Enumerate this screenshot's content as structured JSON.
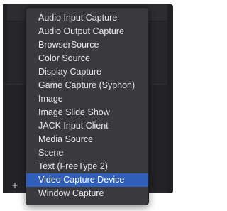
{
  "menu": {
    "items": [
      {
        "label": "Audio Input Capture",
        "selected": false
      },
      {
        "label": "Audio Output Capture",
        "selected": false
      },
      {
        "label": "BrowserSource",
        "selected": false
      },
      {
        "label": "Color Source",
        "selected": false
      },
      {
        "label": "Display Capture",
        "selected": false
      },
      {
        "label": "Game Capture (Syphon)",
        "selected": false
      },
      {
        "label": "Image",
        "selected": false
      },
      {
        "label": "Image Slide Show",
        "selected": false
      },
      {
        "label": "JACK Input Client",
        "selected": false
      },
      {
        "label": "Media Source",
        "selected": false
      },
      {
        "label": "Scene",
        "selected": false
      },
      {
        "label": "Text (FreeType 2)",
        "selected": false
      },
      {
        "label": "Video Capture Device",
        "selected": true
      },
      {
        "label": "Window Capture",
        "selected": false
      }
    ]
  },
  "toolbar": {
    "add_symbol": "+",
    "remove_symbol": "−",
    "icons": [
      "add-icon",
      "remove-icon",
      "gear-icon",
      "chevron-up-icon",
      "chevron-down-icon"
    ]
  },
  "colors": {
    "panel_bg": "#27272a",
    "menu_bg": "#3a3a3d",
    "menu_text": "#ececee",
    "selection_bg": "#2f5fb8",
    "selection_text": "#ffffff",
    "toolbar_icon": "#cfcfd1"
  }
}
